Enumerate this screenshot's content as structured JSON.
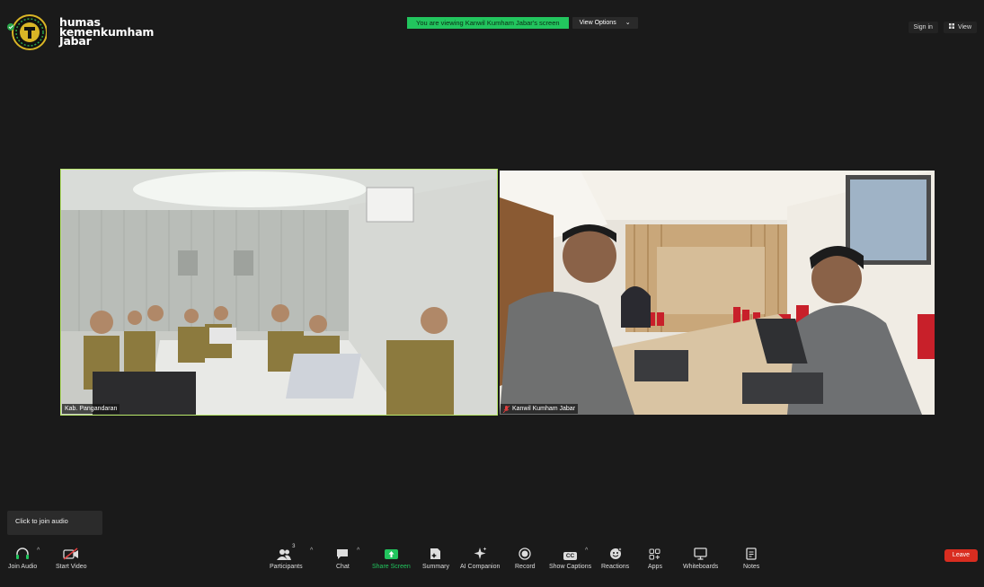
{
  "brand": {
    "line1": "humas",
    "line2": "kemenkumham",
    "line3": "Jabar"
  },
  "banner": {
    "viewing_text": "You are viewing Kanwil Kumham Jabar's screen",
    "view_options_label": "View Options"
  },
  "top_right": {
    "sign_in_label": "Sign in",
    "view_label": "View"
  },
  "video_tiles": [
    {
      "name": "Kab. Pangandaran",
      "active_speaker": true,
      "muted": false
    },
    {
      "name": "Kanwil Kumham Jabar",
      "active_speaker": false,
      "muted": true
    }
  ],
  "tooltip": {
    "text": "Click to join audio"
  },
  "toolbar": {
    "join_audio": "Join Audio",
    "start_video": "Start Video",
    "participants": "Participants",
    "participants_count": "3",
    "chat": "Chat",
    "share_screen": "Share Screen",
    "summary": "Summary",
    "ai_companion": "AI Companion",
    "record": "Record",
    "show_captions": "Show Captions",
    "captions_icon_text": "CC",
    "reactions": "Reactions",
    "apps": "Apps",
    "whiteboards": "Whiteboards",
    "notes": "Notes",
    "leave": "Leave"
  },
  "colors": {
    "share_green": "#22c55e",
    "leave_red": "#d92d20",
    "active_border": "#b9e86a",
    "background": "#1a1a1a"
  }
}
